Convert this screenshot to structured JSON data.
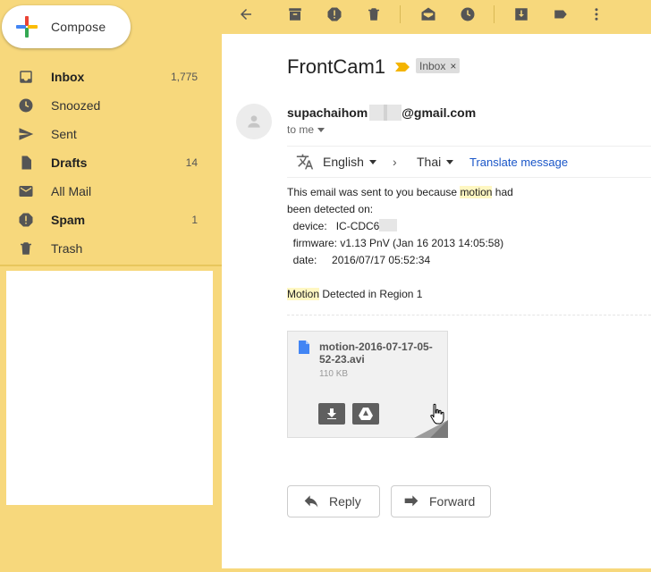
{
  "colors": {
    "sidebar_bg": "#f7d87c",
    "accent_link": "#1a56c8",
    "highlight": "#fff7c2"
  },
  "compose": {
    "label": "Compose"
  },
  "nav": [
    {
      "label": "Inbox",
      "count": "1,775",
      "icon": "inbox-icon",
      "bold": true
    },
    {
      "label": "Snoozed",
      "count": "",
      "icon": "clock-icon",
      "bold": false
    },
    {
      "label": "Sent",
      "count": "",
      "icon": "send-icon",
      "bold": false
    },
    {
      "label": "Drafts",
      "count": "14",
      "icon": "file-icon",
      "bold": true
    },
    {
      "label": "All Mail",
      "count": "",
      "icon": "mail-icon",
      "bold": false
    },
    {
      "label": "Spam",
      "count": "1",
      "icon": "spam-icon",
      "bold": true
    },
    {
      "label": "Trash",
      "count": "",
      "icon": "trash-icon",
      "bold": false
    }
  ],
  "toolbar": {
    "icons": [
      "back-arrow-icon",
      "archive-icon",
      "report-spam-icon",
      "delete-icon",
      "mark-unread-icon",
      "snooze-icon",
      "move-to-icon",
      "label-icon",
      "more-vert-icon"
    ]
  },
  "email": {
    "subject": "FrontCam1",
    "label": "Inbox",
    "label_close": "×",
    "sender_prefix": "supachaihom",
    "sender_suffix": "@gmail.com",
    "to": "to me",
    "translate": {
      "from_lang": "English",
      "arrow": "›",
      "to_lang": "Thai",
      "link": "Translate message"
    },
    "body": {
      "line1_pre": "This email was sent to you because ",
      "line1_hl": "motion",
      "line1_post": " had",
      "line2": "been detected on:",
      "device_label": "  device:   IC-CDC6",
      "firmware_line": "  firmware: v1.13 PnV (Jan 16 2013 14:05:58)",
      "date_line": "  date:     2016/07/17 05:52:34",
      "motion_hl": "Motion",
      "motion_post": " Detected in Region 1"
    },
    "attachment": {
      "name": "motion-2016-07-17-05-52-23.avi",
      "size": "110 KB"
    },
    "reply_label": "Reply",
    "forward_label": "Forward"
  }
}
